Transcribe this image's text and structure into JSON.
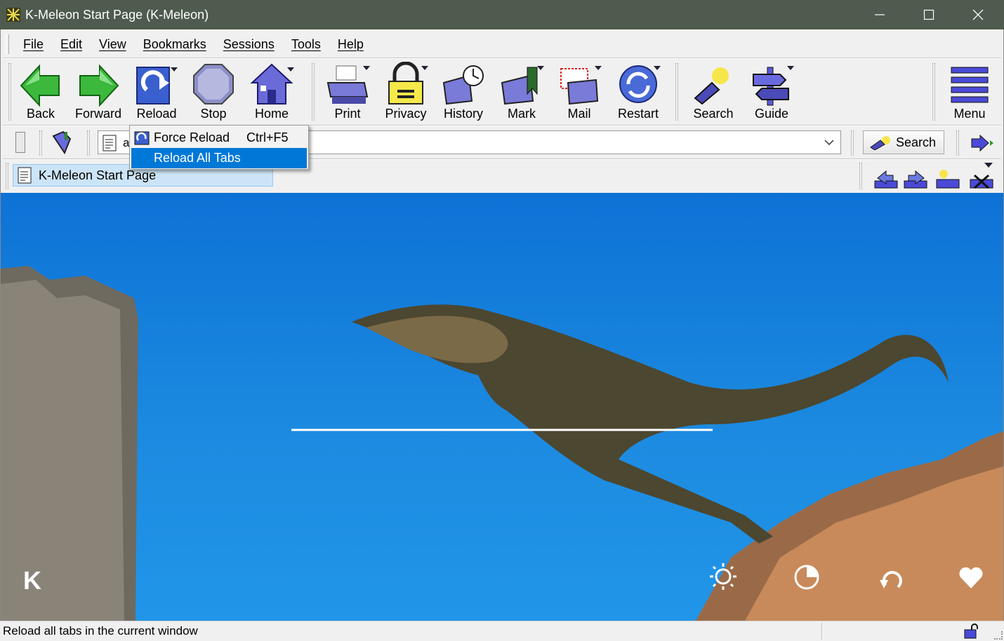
{
  "window": {
    "title": "K-Meleon Start Page (K-Meleon)",
    "controls": [
      "minimize-icon",
      "maximize-icon",
      "close-icon"
    ]
  },
  "menu": [
    "File",
    "Edit",
    "View",
    "Bookmarks",
    "Sessions",
    "Tools",
    "Help"
  ],
  "toolbar": {
    "back": "Back",
    "forward": "Forward",
    "reload": "Reload",
    "stop": "Stop",
    "home": "Home",
    "print": "Print",
    "privacy": "Privacy",
    "history": "History",
    "mark": "Mark",
    "mail": "Mail",
    "restart": "Restart",
    "search": "Search",
    "guide": "Guide",
    "menu": "Menu"
  },
  "address": {
    "visible_fragment": "a"
  },
  "search_button": "Search",
  "tab": {
    "title": "K-Meleon Start Page"
  },
  "reload_menu": {
    "items": [
      {
        "label": "Force Reload",
        "shortcut": "Ctrl+F5"
      },
      {
        "label": "Reload All Tabs",
        "shortcut": ""
      }
    ],
    "selected": "Reload All Tabs"
  },
  "page": {
    "logo_letter": "K",
    "background_icons": [
      "sun-icon",
      "contrast-icon",
      "undo-icon",
      "heart-icon"
    ]
  },
  "status": {
    "text": "Reload all tabs in the current window"
  },
  "colors": {
    "titlebar": "#4e5b4e",
    "highlight": "#0078d7",
    "tab_active": "#cce4f7",
    "sky": "#1c8ae0"
  }
}
